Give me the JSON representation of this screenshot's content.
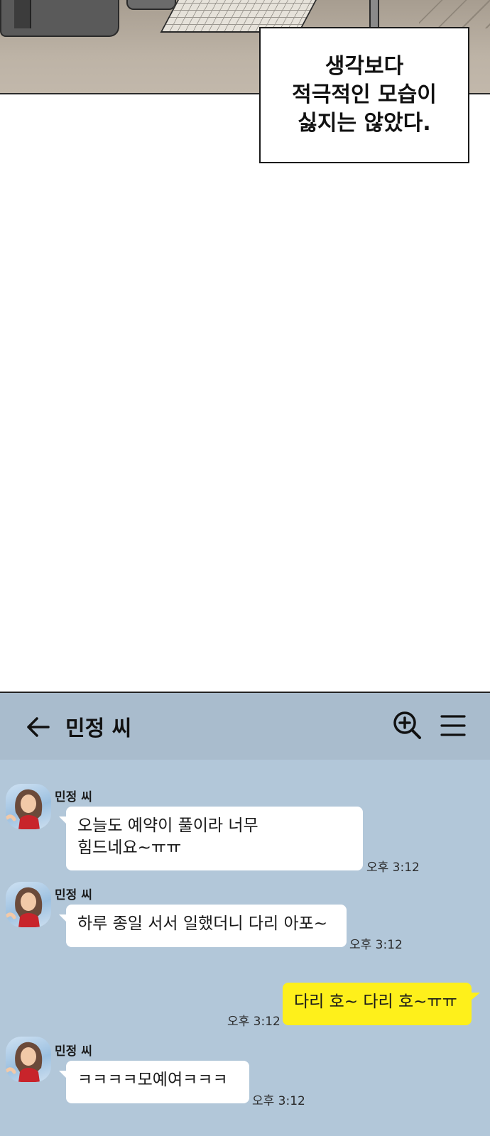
{
  "caption": {
    "text": "생각보다\n적극적인 모습이\n싫지는 않았다."
  },
  "chat": {
    "title": "민정 씨",
    "icons": {
      "back": "back-arrow-icon",
      "search": "zoom-in-icon",
      "menu": "menu-icon"
    },
    "colors": {
      "background": "#b2c7d9",
      "header": "#a9bccd",
      "my_bubble": "#fef01b",
      "their_bubble": "#ffffff"
    },
    "messages": [
      {
        "sender": "민정 씨",
        "text": "오늘도 예약이 풀이라 너무\n힘드네요~ㅠㅠ",
        "time": "오후 3:12"
      },
      {
        "sender": "민정 씨",
        "text": "하루 종일 서서 일했더니 다리 아포~",
        "time": "오후 3:12"
      },
      {
        "sender": "",
        "text": "다리 호~ 다리 호~ㅠㅠ",
        "time": "오후 3:12"
      },
      {
        "sender": "민정 씨",
        "text": "ㅋㅋㅋㅋ모예여ㅋㅋㅋ",
        "time": "오후 3:12"
      }
    ]
  }
}
